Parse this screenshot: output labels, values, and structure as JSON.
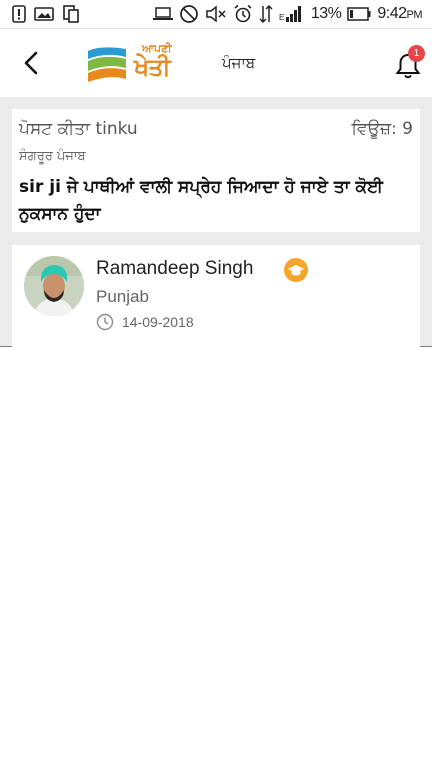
{
  "status_bar": {
    "battery_percent": "13%",
    "time": "9:42",
    "ampm": "PM",
    "icons": [
      "alert-icon",
      "image-icon",
      "copy-icon",
      "laptop-icon",
      "do-not-disturb-icon",
      "mute-icon",
      "alarm-icon",
      "data-icon",
      "signal-icon",
      "battery-icon"
    ]
  },
  "app_bar": {
    "logo_small": "ਆਪਣੀ",
    "logo_big": "ਖੇਤੀ",
    "region": "ਪੰਜਾਬ",
    "notification_count": "1",
    "logo_colors": [
      "#2a9ad3",
      "#7fb845",
      "#e8891c"
    ]
  },
  "post": {
    "posted_by": "ਪੋਸਟ ਕੀਤਾ tinku",
    "views": "ਵਿਊਜ਼: 9",
    "location": "ਸੰਗਰੂਰ ਪੰਜਾਬ",
    "question": "sir ji ਜੇ ਪਾਥੀਆਂ ਵਾਲੀ ਸਪ੍ਰੇਹ ਜਿਆਦਾ ਹੋ ਜਾਏ ਤਾ ਕੋਈ ਨੁਕਸਾਨ ਹੁੰਦਾ"
  },
  "reply": {
    "user_name": "Ramandeep Singh",
    "state": "Punjab",
    "date": "14-09-2018",
    "badge_color": "#f4a62a"
  }
}
